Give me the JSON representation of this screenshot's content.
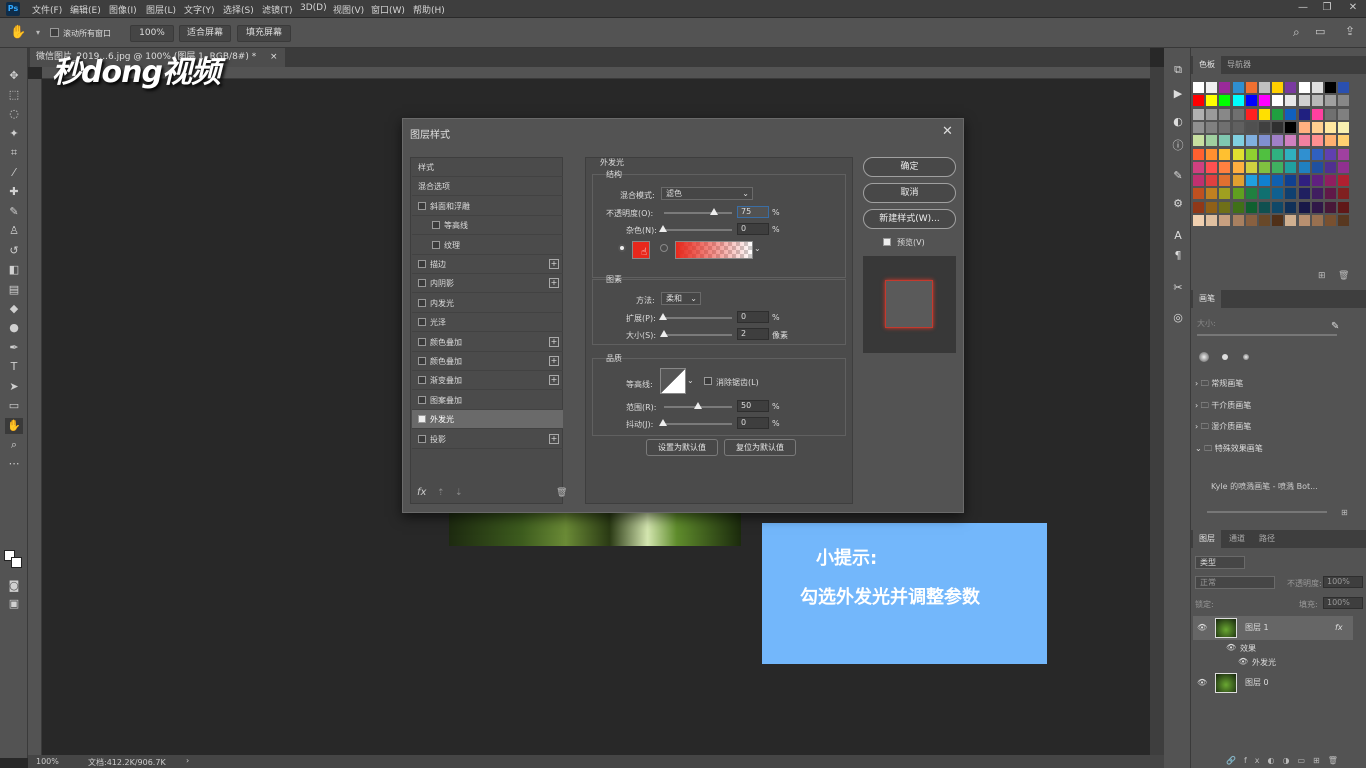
{
  "app": {
    "name": "Ps"
  },
  "menubar": {
    "items": [
      "文件(F)",
      "编辑(E)",
      "图像(I)",
      "图层(L)",
      "文字(Y)",
      "选择(S)",
      "滤镜(T)",
      "3D(D)",
      "视图(V)",
      "窗口(W)",
      "帮助(H)"
    ]
  },
  "options": {
    "scroll_all_label": "滚动所有窗口",
    "zoom_value": "100%",
    "fit_screen": "适合屏幕",
    "fill_screen": "填充屏幕"
  },
  "document": {
    "tab_label": "微信图片_2019...6.jpg @ 100% (图层 1, RGB/8#) *",
    "close": "×"
  },
  "watermark": {
    "text": "秒dong视频"
  },
  "statusbar": {
    "zoom": "100%",
    "doc_info": "文档:412.2K/906.7K",
    "arrow": "›"
  },
  "tip": {
    "title": "小提示:",
    "body": "勾选外发光并调整参数"
  },
  "dialog": {
    "title": "图层样式",
    "close": "✕",
    "styles": [
      {
        "label": "样式",
        "checkbox": false,
        "plus": false,
        "indent": 0
      },
      {
        "label": "混合选项",
        "checkbox": false,
        "plus": false,
        "indent": 0
      },
      {
        "label": "斜面和浮雕",
        "checkbox": true,
        "checked": false,
        "plus": false,
        "indent": 0
      },
      {
        "label": "等高线",
        "checkbox": true,
        "checked": false,
        "plus": false,
        "indent": 1
      },
      {
        "label": "纹理",
        "checkbox": true,
        "checked": false,
        "plus": false,
        "indent": 1
      },
      {
        "label": "描边",
        "checkbox": true,
        "checked": false,
        "plus": true,
        "indent": 0
      },
      {
        "label": "内阴影",
        "checkbox": true,
        "checked": false,
        "plus": true,
        "indent": 0
      },
      {
        "label": "内发光",
        "checkbox": true,
        "checked": false,
        "plus": false,
        "indent": 0
      },
      {
        "label": "光泽",
        "checkbox": true,
        "checked": false,
        "plus": false,
        "indent": 0
      },
      {
        "label": "颜色叠加",
        "checkbox": true,
        "checked": false,
        "plus": true,
        "indent": 0
      },
      {
        "label": "颜色叠加",
        "checkbox": true,
        "checked": false,
        "plus": true,
        "indent": 0
      },
      {
        "label": "渐变叠加",
        "checkbox": true,
        "checked": false,
        "plus": true,
        "indent": 0
      },
      {
        "label": "图案叠加",
        "checkbox": true,
        "checked": false,
        "plus": false,
        "indent": 0
      },
      {
        "label": "外发光",
        "checkbox": true,
        "checked": true,
        "plus": false,
        "indent": 0,
        "selected": true
      },
      {
        "label": "投影",
        "checkbox": true,
        "checked": false,
        "plus": true,
        "indent": 0
      }
    ],
    "fx": "fx",
    "outer_glow": {
      "heading": "外发光",
      "structure": {
        "heading": "结构",
        "blend_mode_label": "混合模式:",
        "blend_mode_value": "滤色",
        "opacity_label": "不透明度(O):",
        "opacity_value": "75",
        "opacity_unit": "%",
        "noise_label": "杂色(N):",
        "noise_value": "0",
        "noise_unit": "%",
        "color": "#e8281c"
      },
      "elements": {
        "heading": "图素",
        "method_label": "方法:",
        "method_value": "柔和",
        "spread_label": "扩展(P):",
        "spread_value": "0",
        "spread_unit": "%",
        "size_label": "大小(S):",
        "size_value": "2",
        "size_unit": "像素"
      },
      "quality": {
        "heading": "品质",
        "contour_label": "等高线:",
        "antialias_label": "消除锯齿(L)",
        "range_label": "范围(R):",
        "range_value": "50",
        "range_unit": "%",
        "jitter_label": "抖动(J):",
        "jitter_value": "0",
        "jitter_unit": "%"
      },
      "set_default": "设置为默认值",
      "reset_default": "复位为默认值"
    },
    "buttons": {
      "ok": "确定",
      "cancel": "取消",
      "new_style": "新建样式(W)...",
      "preview": "预览(V)"
    }
  },
  "swatches_panel": {
    "tabs": [
      "色板",
      "导航器"
    ],
    "colors": [
      "#ffffff",
      "#f0f0f0",
      "#9a2a9a",
      "#2e8fd0",
      "#f07030",
      "#c0c0c0",
      "#ffd000",
      "#7a3aa0",
      "#ffffff",
      "#e0e0e0",
      "#000000",
      "#2a50b0",
      "#ff0000",
      "#ffff00",
      "#00ff00",
      "#00ffff",
      "#0000ff",
      "#ff00ff",
      "#ffffff",
      "#e8e8e8",
      "#d0d0d0",
      "#b8b8b8",
      "#a0a0a0",
      "#888888",
      "#b0b0b0",
      "#9a9a9a",
      "#888888",
      "#707070",
      "#ff2020",
      "#ffe000",
      "#20a040",
      "#1060c0",
      "#202080",
      "#ff40a0",
      "#707070",
      "#808080",
      "#909090",
      "#808080",
      "#707070",
      "#606060",
      "#505050",
      "#404040",
      "#303030",
      "#000000",
      "#ffb080",
      "#ffd090",
      "#ffe8a0",
      "#f8f0b0",
      "#c8e0a0",
      "#a0d0a0",
      "#80c8b0",
      "#80d0e0",
      "#80b0e0",
      "#8090d0",
      "#a080c8",
      "#d080c0",
      "#f080a0",
      "#ff9090",
      "#ffb070",
      "#ffd070",
      "#ff6030",
      "#ff9030",
      "#ffc030",
      "#e0e030",
      "#90d030",
      "#50c040",
      "#30b080",
      "#30b0c0",
      "#3090d0",
      "#3060c0",
      "#6040b0",
      "#a040a0",
      "#d04080",
      "#ff5050",
      "#ff8040",
      "#ffb040",
      "#d0d040",
      "#80c040",
      "#40b060",
      "#20a0a0",
      "#2080c0",
      "#2050a0",
      "#503090",
      "#903090",
      "#c03070",
      "#e04040",
      "#e07030",
      "#e0a030",
      "#20a0e0",
      "#1080d0",
      "#1060b0",
      "#104090",
      "#302080",
      "#602080",
      "#901e60",
      "#b02030",
      "#c05020",
      "#c08020",
      "#a0a020",
      "#60a020",
      "#208040",
      "#107070",
      "#106090",
      "#104070",
      "#202060",
      "#401e60",
      "#601848",
      "#802020",
      "#903818",
      "#906018",
      "#707018",
      "#407018",
      "#106030",
      "#105050",
      "#104868",
      "#103058",
      "#181848",
      "#301848",
      "#481838",
      "#601818",
      "#f0d0b0",
      "#e0c0a0",
      "#c8a080",
      "#a88060",
      "#886040",
      "#684828",
      "#503018",
      "#d0b090",
      "#b89070",
      "#987050",
      "#785030",
      "#583820"
    ]
  },
  "brush_panel": {
    "tab": "画笔",
    "size_label": "大小:",
    "folders": [
      "常规画笔",
      "干介质画笔",
      "湿介质画笔",
      "特殊效果画笔"
    ],
    "brush_item": "Kyle 的喷溅画笔 - 喷溅 Bot..."
  },
  "layers_panel": {
    "tabs": [
      "图层",
      "通道",
      "路径"
    ],
    "kind_label": "类型",
    "blend_mode": "正常",
    "opacity_label": "不透明度:",
    "opacity_value": "100%",
    "lock_label": "锁定:",
    "fill_label": "填充:",
    "fill_value": "100%",
    "layers": [
      {
        "name": "图层 1",
        "fx": "fx",
        "effects_label": "效果",
        "effect": "外发光"
      },
      {
        "name": "图层 0"
      }
    ]
  }
}
